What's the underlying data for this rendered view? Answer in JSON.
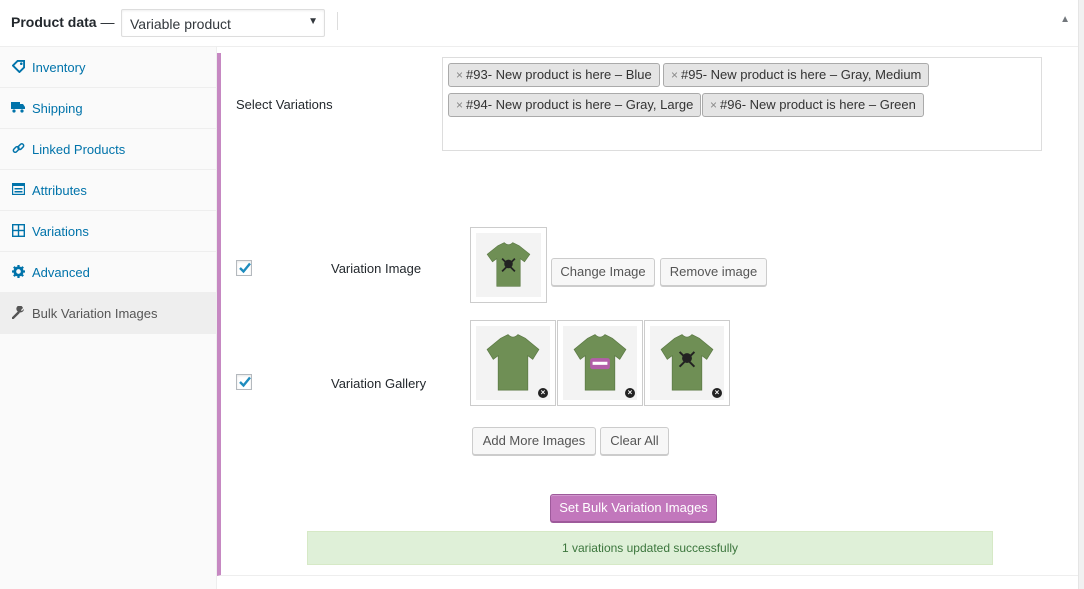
{
  "header": {
    "title": "Product data",
    "dash": "—",
    "product_type": "Variable product",
    "select_arrow": "▼",
    "collapse_arrow": "▲"
  },
  "sidebar": {
    "items": [
      {
        "label": "Inventory",
        "icon": "tag-icon"
      },
      {
        "label": "Shipping",
        "icon": "truck-icon"
      },
      {
        "label": "Linked Products",
        "icon": "link-icon"
      },
      {
        "label": "Attributes",
        "icon": "list-icon"
      },
      {
        "label": "Variations",
        "icon": "grid-icon"
      },
      {
        "label": "Advanced",
        "icon": "gear-icon"
      },
      {
        "label": "Bulk Variation Images",
        "icon": "wrench-icon",
        "active": true
      }
    ]
  },
  "main": {
    "select_variations_label": "Select Variations",
    "chips": [
      {
        "remove": "×",
        "label": "#93- New product is here – Blue"
      },
      {
        "remove": "×",
        "label": "#95- New product is here – Gray, Medium"
      },
      {
        "remove": "×",
        "label": "#94- New product is here – Gray, Large"
      },
      {
        "remove": "×",
        "label": "#96- New product is here – Green"
      }
    ],
    "variation_image": {
      "checked": true,
      "label": "Variation Image",
      "change_button": "Change Image",
      "remove_button": "Remove image"
    },
    "variation_gallery": {
      "checked": true,
      "label": "Variation Gallery",
      "images": [
        "tshirt-green-front",
        "tshirt-green-woo",
        "tshirt-green-skull"
      ],
      "remove_symbol": "×",
      "add_more_button": "Add More Images",
      "clear_all_button": "Clear All"
    },
    "submit_button": "Set Bulk Variation Images",
    "notice": "1 variations updated successfully"
  },
  "colors": {
    "accent": "#c688c2",
    "primary_button": "#c277bc",
    "link": "#0073aa",
    "notice_bg": "#dff0d8",
    "shirt_green": "#6f8f55"
  }
}
